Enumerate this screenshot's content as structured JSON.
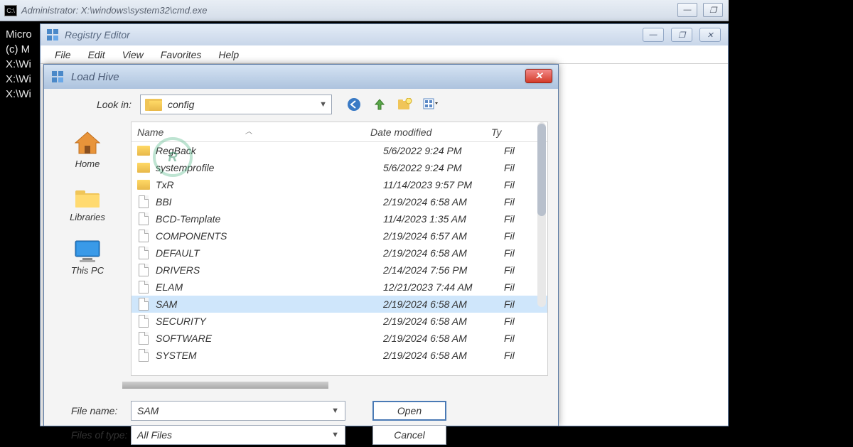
{
  "cmd": {
    "title": "Administrator: X:\\windows\\system32\\cmd.exe",
    "icon_text": "C:\\",
    "lines": [
      "Micro",
      "(c) M",
      "",
      "X:\\Wi",
      "",
      "X:\\Wi",
      "",
      "X:\\Wi"
    ]
  },
  "cmd_controls": {
    "minimize": "—",
    "maximize": "❐"
  },
  "regedit": {
    "title": "Registry Editor",
    "menu": [
      "File",
      "Edit",
      "View",
      "Favorites",
      "Help"
    ]
  },
  "regedit_controls": {
    "minimize": "—",
    "maximize": "❐",
    "close": "✕"
  },
  "dialog": {
    "title": "Load Hive",
    "lookin_label": "Look in:",
    "lookin_value": "config",
    "columns": {
      "name": "Name",
      "date": "Date modified",
      "type": "Ty"
    },
    "sidebar": [
      {
        "label": "Home",
        "key": "home"
      },
      {
        "label": "Libraries",
        "key": "libraries"
      },
      {
        "label": "This PC",
        "key": "thispc"
      }
    ],
    "files": [
      {
        "name": "RegBack",
        "date": "5/6/2022 9:24 PM",
        "type": "Fil",
        "kind": "folder"
      },
      {
        "name": "systemprofile",
        "date": "5/6/2022 9:24 PM",
        "type": "Fil",
        "kind": "folder"
      },
      {
        "name": "TxR",
        "date": "11/14/2023 9:57 PM",
        "type": "Fil",
        "kind": "folder"
      },
      {
        "name": "BBI",
        "date": "2/19/2024 6:58 AM",
        "type": "Fil",
        "kind": "file"
      },
      {
        "name": "BCD-Template",
        "date": "11/4/2023 1:35 AM",
        "type": "Fil",
        "kind": "file"
      },
      {
        "name": "COMPONENTS",
        "date": "2/19/2024 6:57 AM",
        "type": "Fil",
        "kind": "file"
      },
      {
        "name": "DEFAULT",
        "date": "2/19/2024 6:58 AM",
        "type": "Fil",
        "kind": "file"
      },
      {
        "name": "DRIVERS",
        "date": "2/14/2024 7:56 PM",
        "type": "Fil",
        "kind": "file"
      },
      {
        "name": "ELAM",
        "date": "12/21/2023 7:44 AM",
        "type": "Fil",
        "kind": "file"
      },
      {
        "name": "SAM",
        "date": "2/19/2024 6:58 AM",
        "type": "Fil",
        "kind": "file",
        "selected": true
      },
      {
        "name": "SECURITY",
        "date": "2/19/2024 6:58 AM",
        "type": "Fil",
        "kind": "file"
      },
      {
        "name": "SOFTWARE",
        "date": "2/19/2024 6:58 AM",
        "type": "Fil",
        "kind": "file"
      },
      {
        "name": "SYSTEM",
        "date": "2/19/2024 6:58 AM",
        "type": "Fil",
        "kind": "file"
      }
    ],
    "file_name_label": "File name:",
    "file_name_value": "SAM",
    "file_type_label": "Files of type:",
    "file_type_value": "All Files",
    "open_button": "Open",
    "cancel_button": "Cancel",
    "close_x": "✕"
  }
}
